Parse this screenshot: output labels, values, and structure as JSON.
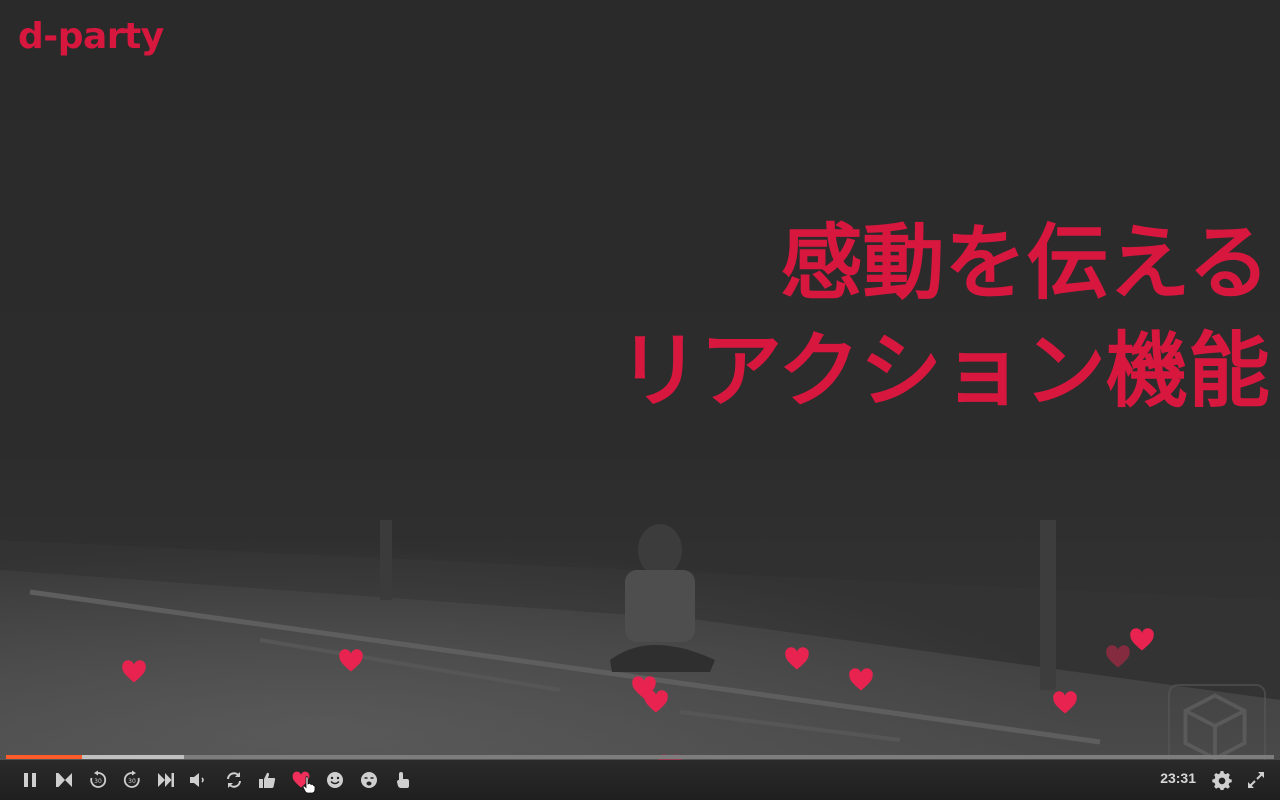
{
  "brand": {
    "logo_text": "d-party",
    "color": "#d8173f"
  },
  "headline": {
    "line1": "感動を伝える",
    "line2": "リアクション機能",
    "color": "#d8173f"
  },
  "video": {
    "reaction_overlay": "heart",
    "progress": {
      "played_fraction": 0.06,
      "buffered_fraction": 0.14,
      "played_color": "#ff5a2a"
    }
  },
  "player": {
    "time": "23:31",
    "buttons": [
      {
        "name": "pause",
        "icon": "pause-icon"
      },
      {
        "name": "previous",
        "icon": "skip-previous-icon"
      },
      {
        "name": "rewind-30",
        "icon": "rewind-30-icon"
      },
      {
        "name": "forward-30",
        "icon": "forward-30-icon"
      },
      {
        "name": "next",
        "icon": "skip-next-icon"
      },
      {
        "name": "volume",
        "icon": "volume-icon"
      },
      {
        "name": "loop",
        "icon": "loop-icon"
      },
      {
        "name": "reaction-like",
        "icon": "thumbs-up-icon"
      },
      {
        "name": "reaction-heart",
        "icon": "heart-icon",
        "active": true
      },
      {
        "name": "reaction-smile",
        "icon": "smile-icon"
      },
      {
        "name": "reaction-cry",
        "icon": "crying-face-icon"
      },
      {
        "name": "reaction-clap",
        "icon": "clap-hand-icon"
      },
      {
        "name": "settings",
        "icon": "gear-icon"
      },
      {
        "name": "fullscreen",
        "icon": "fullscreen-icon"
      }
    ]
  }
}
